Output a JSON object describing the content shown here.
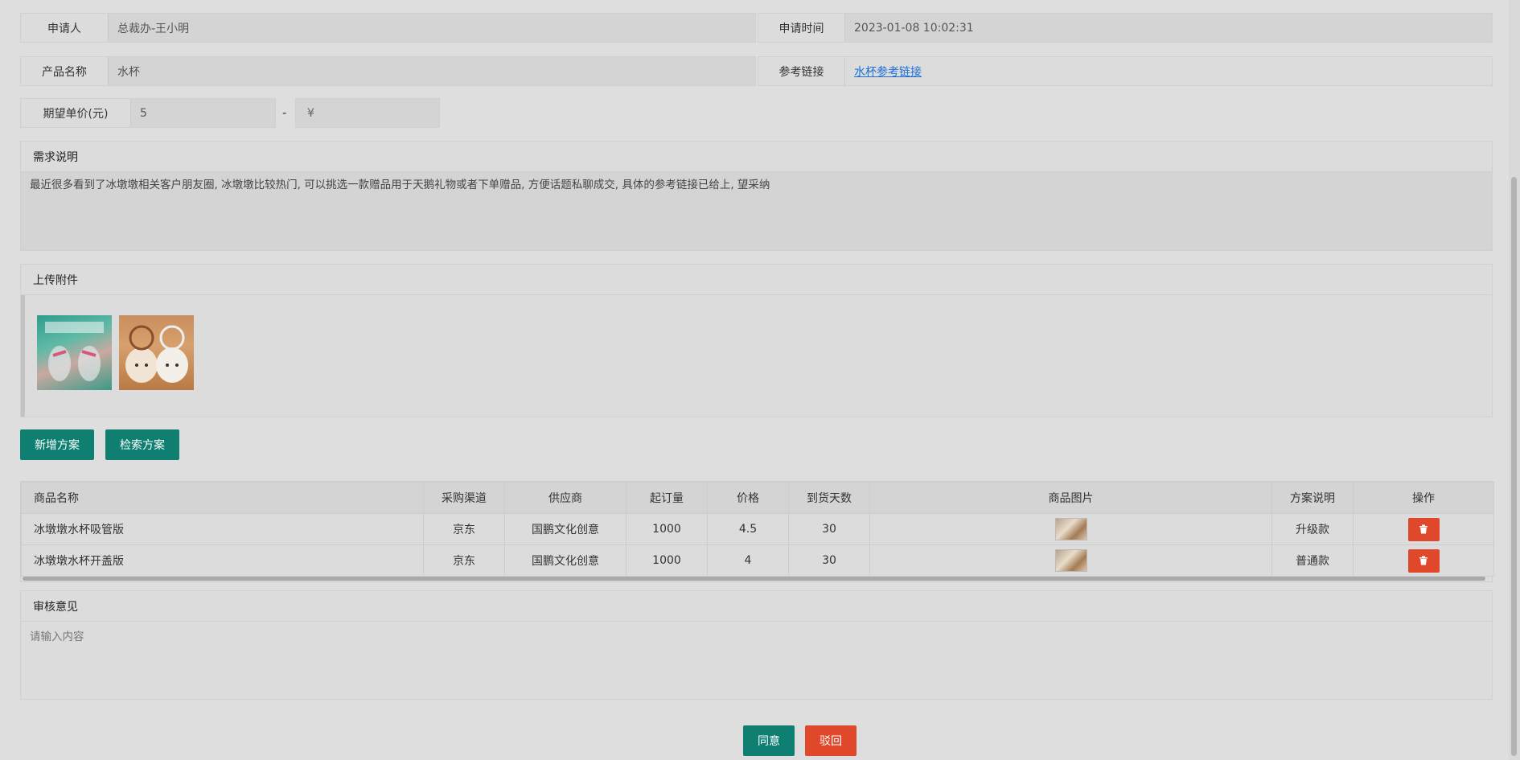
{
  "applicant": {
    "label": "申请人",
    "value": "总裁办-王小明"
  },
  "apply_time": {
    "label": "申请时间",
    "value": "2023-01-08 10:02:31"
  },
  "product_name": {
    "label": "产品名称",
    "value": "水杯"
  },
  "reference_link": {
    "label": "参考链接",
    "value": "水杯参考链接"
  },
  "expected_price": {
    "label": "期望单价(元)",
    "min": "5",
    "separator": "-",
    "max_placeholder": "¥"
  },
  "requirement": {
    "title": "需求说明",
    "text": "最近很多看到了冰墩墩相关客户朋友圈, 冰墩墩比较热门, 可以挑选一款赠品用于天鹅礼物或者下单赠品, 方便话题私聊成交, 具体的参考链接已给上, 望采纳"
  },
  "attachments": {
    "title": "上传附件"
  },
  "actions": {
    "add_plan": "新增方案",
    "search_plan": "检索方案"
  },
  "table": {
    "headers": [
      "商品名称",
      "采购渠道",
      "供应商",
      "起订量",
      "价格",
      "到货天数",
      "商品图片",
      "方案说明",
      "操作"
    ],
    "rows": [
      {
        "name": "冰墩墩水杯吸管版",
        "channel": "京东",
        "supplier": "国鹏文化创意",
        "moq": "1000",
        "price": "4.5",
        "days": "30",
        "note": "升级款"
      },
      {
        "name": "冰墩墩水杯开盖版",
        "channel": "京东",
        "supplier": "国鹏文化创意",
        "moq": "1000",
        "price": "4",
        "days": "30",
        "note": "普通款"
      }
    ]
  },
  "review": {
    "title": "审核意见",
    "placeholder": "请输入内容"
  },
  "footer": {
    "approve": "同意",
    "reject": "驳回"
  },
  "colors": {
    "teal": "#0f7f72",
    "red": "#e0482c",
    "link": "#1e6fd9"
  }
}
